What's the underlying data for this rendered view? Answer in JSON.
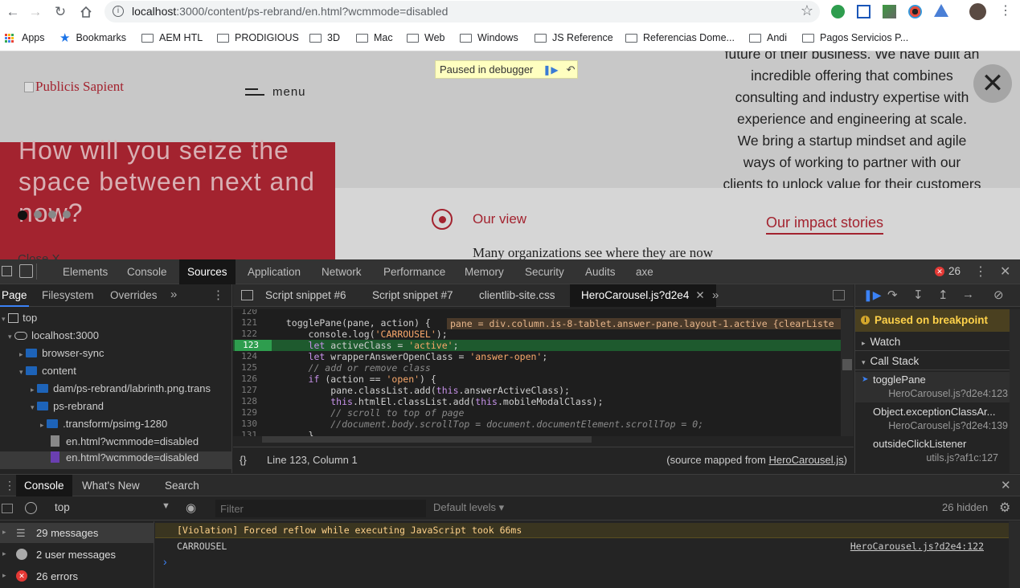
{
  "browser": {
    "url_host": "localhost",
    "url_rest": ":3000/content/ps-rebrand/en.html?wcmmode=disabled",
    "bookmarks": [
      "Apps",
      "Bookmarks",
      "AEM HTL",
      "PRODIGIOUS",
      "3D",
      "Mac",
      "Web",
      "Windows",
      "JS Reference",
      "Referencias Dome...",
      "Andi",
      "Pagos Servicios P..."
    ]
  },
  "page": {
    "logo_alt": "Publicis Sapient",
    "menu_label": "menu",
    "paused_label": "Paused in debugger",
    "hero_title": "How will you seize the space between next and now?",
    "right_text_lines": [
      "future of their business. We have built an",
      "incredible offering that combines",
      "consulting and industry expertise with",
      "experience and engineering at scale.",
      "We bring a startup mindset and agile",
      "ways of working to partner with our",
      "clients to unlock value for their customers"
    ],
    "our_view": "Our view",
    "impact": "Our impact stories",
    "many_orgs": "Many organizations see where they are now",
    "close_stub": "Close X"
  },
  "devtools": {
    "tabs": [
      "Elements",
      "Console",
      "Sources",
      "Application",
      "Network",
      "Performance",
      "Memory",
      "Security",
      "Audits",
      "axe"
    ],
    "active_tab": "Sources",
    "error_count": "26",
    "nav_tabs": [
      "Page",
      "Filesystem",
      "Overrides"
    ],
    "tree": [
      "top",
      "localhost:3000",
      "browser-sync",
      "content",
      "dam/ps-rebrand/labrinth.png.trans",
      "ps-rebrand",
      ".transform/psimg-1280",
      "en.html?wcmmode=disabled",
      "en.html?wcmmode=disabled"
    ],
    "editor_tabs": [
      "Script snippet #6",
      "Script snippet #7",
      "clientlib-site.css",
      "HeroCarousel.js?d2e4"
    ],
    "code_lines": [
      {
        "n": "120",
        "t": ""
      },
      {
        "n": "121",
        "t": "  togglePane(pane, action) {"
      },
      {
        "n": "122",
        "t": "      console.log('CARROUSEL');"
      },
      {
        "n": "123",
        "t": "      let activeClass = 'active';"
      },
      {
        "n": "124",
        "t": "      let wrapperAnswerOpenClass = 'answer-open';"
      },
      {
        "n": "125",
        "t": "      // add or remove class"
      },
      {
        "n": "126",
        "t": "      if (action == 'open') {"
      },
      {
        "n": "127",
        "t": "          pane.classList.add(this.answerActiveClass);"
      },
      {
        "n": "128",
        "t": "          this.htmlEl.classList.add(this.mobileModalClass);"
      },
      {
        "n": "129",
        "t": "          // scroll to top of page"
      },
      {
        "n": "130",
        "t": "          //document.body.scrollTop = document.documentElement.scrollTop = 0;"
      },
      {
        "n": "131",
        "t": "      }"
      }
    ],
    "inline_value": "pane = div.column.is-8-tablet.answer-pane.layout-1.active {clearListe",
    "status_pos": "Line 123, Column 1",
    "source_mapped_prefix": "(source mapped from ",
    "source_mapped_file": "HeroCarousel.js",
    "source_mapped_suffix": ")",
    "paused_on_breakpoint": "Paused on breakpoint",
    "watch": "Watch",
    "call_stack": "Call Stack",
    "stack": [
      {
        "fn": "togglePane",
        "loc": "HeroCarousel.js?d2e4:123"
      },
      {
        "fn": "Object.exceptionClassAr...",
        "loc": "HeroCarousel.js?d2e4:139"
      },
      {
        "fn": "outsideClickListener",
        "loc": "utils.js?af1c:127"
      }
    ],
    "drawer_tabs": [
      "Console",
      "What's New",
      "Search"
    ],
    "context": "top",
    "filter_placeholder": "Filter",
    "default_levels": "Default levels ▾",
    "hidden": "26 hidden",
    "sidebar": [
      "29 messages",
      "2 user messages",
      "26 errors"
    ],
    "violation": "[Violation] Forced reflow while executing JavaScript took 66ms",
    "log_text": "CARROUSEL",
    "log_src": "HeroCarousel.js?d2e4:122"
  }
}
